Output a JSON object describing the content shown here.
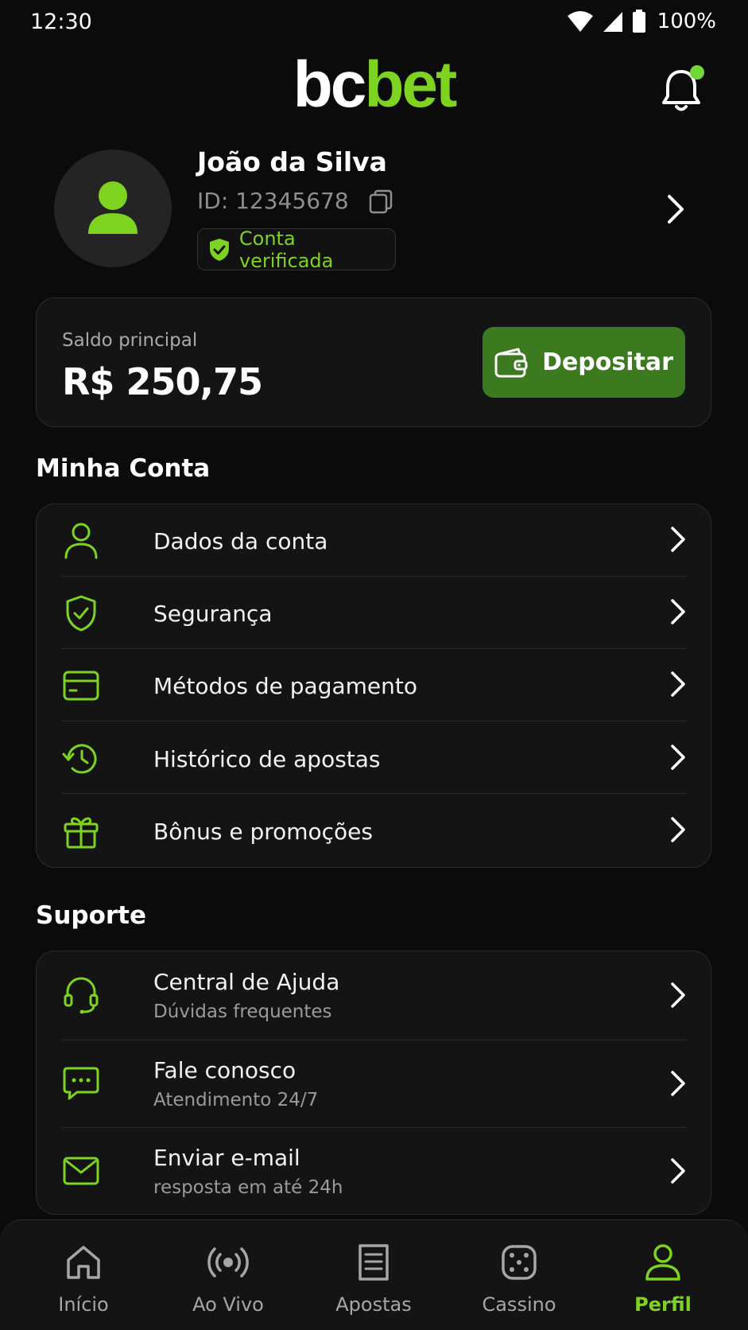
{
  "status_bar": {
    "time": "12:30",
    "battery": "100%"
  },
  "header": {
    "logo_part1": "bc",
    "logo_part2": "bet"
  },
  "profile": {
    "name": "João da Silva",
    "id_text": "ID: 12345678",
    "verified_label": "Conta verificada"
  },
  "balance": {
    "label": "Saldo principal",
    "value": "R$ 250,75",
    "deposit_label": "Depositar"
  },
  "minha_conta": {
    "title": "Minha Conta",
    "items": [
      {
        "label": "Dados da conta",
        "icon": "user-icon"
      },
      {
        "label": "Segurança",
        "icon": "shield-check-icon"
      },
      {
        "label": "Métodos de pagamento",
        "icon": "credit-card-icon"
      },
      {
        "label": "Histórico de apostas",
        "icon": "history-icon"
      },
      {
        "label": "Bônus e promoções",
        "icon": "gift-icon"
      }
    ]
  },
  "suporte": {
    "title": "Suporte",
    "items": [
      {
        "label": "Central de Ajuda",
        "sub": "Dúvidas frequentes",
        "icon": "headset-icon"
      },
      {
        "label": "Fale conosco",
        "sub": "Atendimento 24/7",
        "icon": "chat-icon"
      },
      {
        "label": "Enviar e-mail",
        "sub": "resposta em até 24h",
        "icon": "mail-icon"
      }
    ]
  },
  "bottom_nav": {
    "items": [
      {
        "label": "Início",
        "icon": "home-icon"
      },
      {
        "label": "Ao Vivo",
        "icon": "live-broadcast-icon"
      },
      {
        "label": "Apostas",
        "icon": "betslip-icon"
      },
      {
        "label": "Cassino",
        "icon": "dice-icon"
      },
      {
        "label": "Perfil",
        "icon": "profile-icon",
        "active": true
      }
    ]
  },
  "colors": {
    "accent": "#7ed321",
    "button": "#3b7a1e",
    "background": "#0b0b0c",
    "card": "#141414"
  }
}
